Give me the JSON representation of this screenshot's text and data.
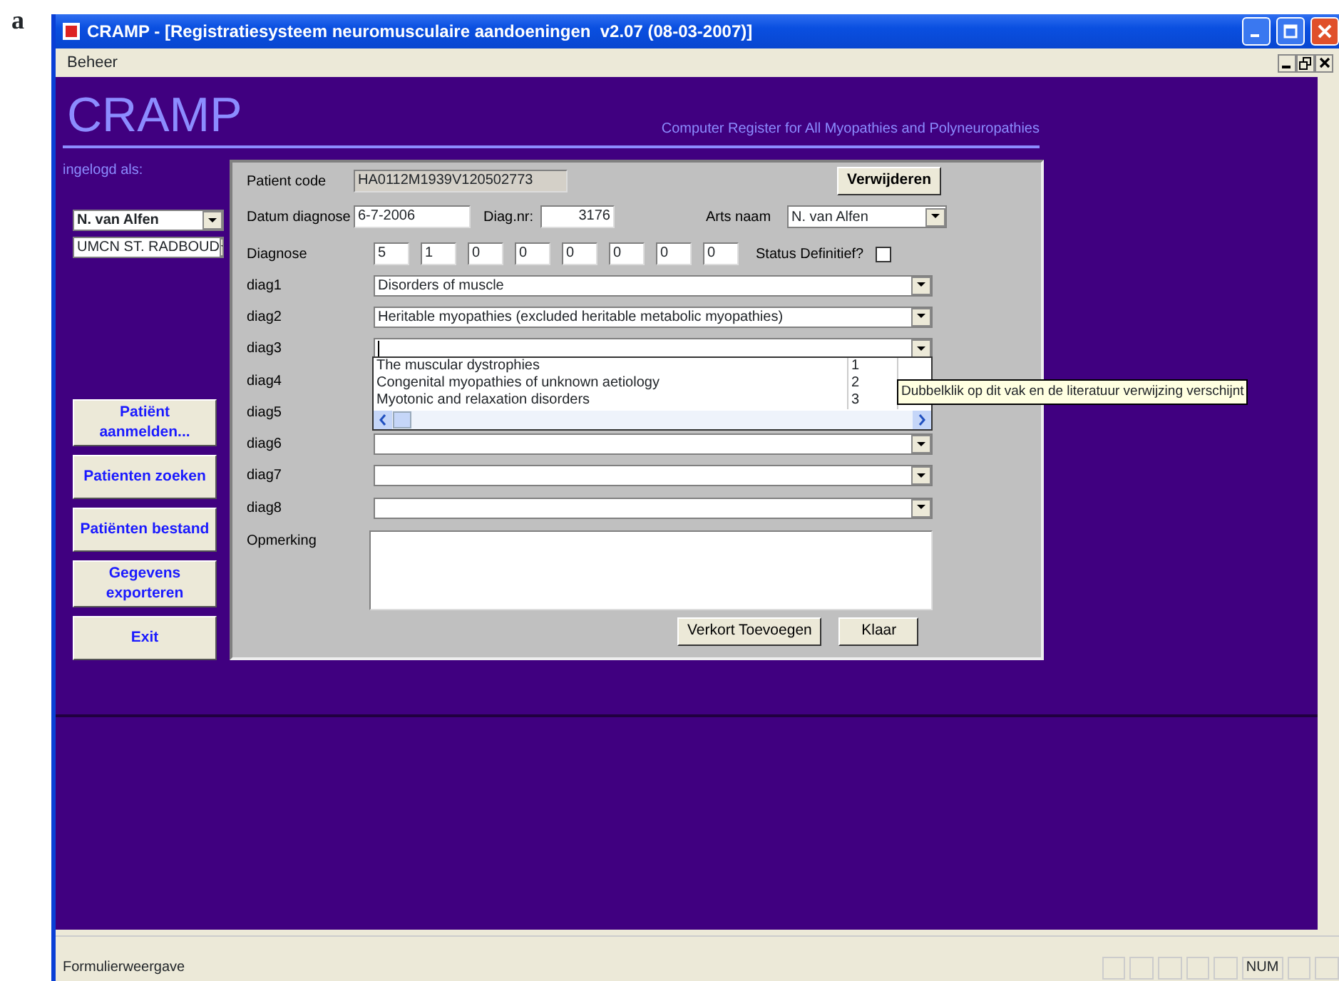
{
  "figure_label": "a",
  "window": {
    "title": "CRAMP - [Registratiesysteem neuromusculaire aandoeningen  v2.07 (08-03-2007)]"
  },
  "menu": [
    "Beheer"
  ],
  "header": {
    "title": "CRAMP",
    "subtitle": "Computer Register for All Myopathies and Polyneuropathies"
  },
  "login": {
    "label": "ingelogd als:",
    "user": "N. van Alfen",
    "site": "UMCN ST. RADBOUD"
  },
  "nav_buttons": [
    "Patiënt aanmelden...",
    "Patienten zoeken",
    "Patiënten bestand",
    "Gegevens exporteren",
    "Exit"
  ],
  "form": {
    "patient_code": {
      "label": "Patient code",
      "value": "HA0112M1939V120502773"
    },
    "delete_button": "Verwijderen",
    "date": {
      "label": "Datum diagnose",
      "value": "6-7-2006"
    },
    "diag_nr": {
      "label": "Diag.nr:",
      "value": "3176"
    },
    "doctor": {
      "label": "Arts naam",
      "value": "N. van Alfen"
    },
    "diagnose": {
      "label": "Diagnose",
      "codes": [
        "5",
        "1",
        "0",
        "0",
        "0",
        "0",
        "0",
        "0"
      ]
    },
    "status": {
      "label": "Status Definitief?",
      "checked": false
    },
    "diag_rows": [
      {
        "label": "diag1",
        "value": "Disorders of muscle",
        "focused": false,
        "covered": false
      },
      {
        "label": "diag2",
        "value": "Heritable myopathies (excluded heritable metabolic myopathies)",
        "focused": false,
        "covered": false
      },
      {
        "label": "diag3",
        "focused": true,
        "covered": false,
        "dropdown": [
          {
            "text": "The muscular dystrophies",
            "code": "1"
          },
          {
            "text": "Congenital myopathies of unknown aetiology",
            "code": "2"
          },
          {
            "text": "Myotonic and relaxation disorders",
            "code": "3"
          }
        ]
      },
      {
        "label": "diag4",
        "covered": true
      },
      {
        "label": "diag5",
        "covered": true
      },
      {
        "label": "diag6",
        "focused": false,
        "covered": false
      },
      {
        "label": "diag7",
        "focused": false,
        "covered": false
      },
      {
        "label": "diag8",
        "focused": false,
        "covered": false
      }
    ],
    "tooltip": "Dubbelklik op dit vak en de literatuur verwijzing verschijnt",
    "remark": {
      "label": "Opmerking"
    },
    "buttons": [
      "Verkort Toevoegen",
      "Klaar"
    ]
  },
  "status_bar": {
    "text": "Formulierweergave",
    "indicators": [
      "NUM"
    ]
  }
}
